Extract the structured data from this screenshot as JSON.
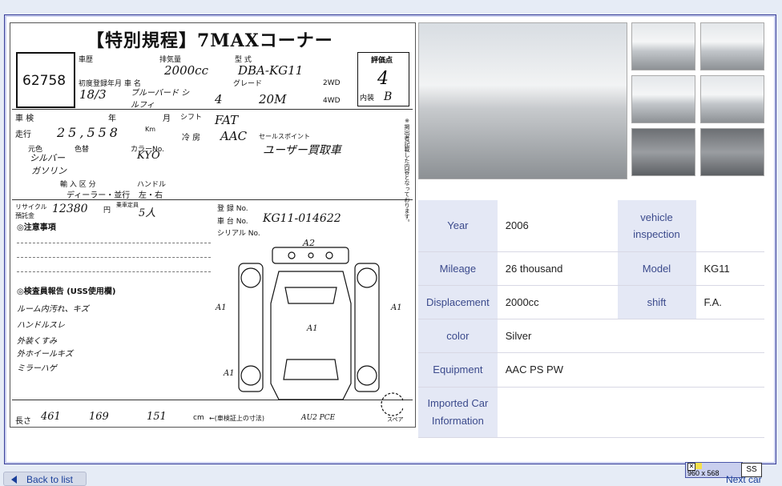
{
  "sheet": {
    "title": "【特別規程】7MAXコーナー",
    "lot_number": "62758",
    "grade_label": "評価点",
    "grade_value": "4",
    "interior_label": "内装",
    "interior_value": "B",
    "vehicle_history_label": "車歴",
    "displacement_label": "排気量",
    "displacement_value": "2000cc",
    "type_label": "型 式",
    "type_value": "DBA-KG11",
    "first_reg_label": "初度登録年月",
    "first_reg_value": "18/3",
    "name_label": "車 名",
    "name_value": "ブルーバード シルフィ",
    "doors_value": "4",
    "grade_text_label": "グレード",
    "grade_text_value": "20M",
    "drive_2wd": "2WD",
    "drive_4wd": "4WD",
    "inspection_label": "車 検",
    "inspection_year": "年",
    "inspection_month": "月",
    "shift_label": "シフト",
    "shift_value": "FAT",
    "mileage_label": "走行",
    "mileage_value": "25,558",
    "mileage_unit": "Km",
    "ac_label": "冷 房",
    "ac_value": "AAC",
    "color_label": "色替",
    "color_original_label": "元色",
    "color_original_value": "シルバー",
    "color_number_label": "カラーNo.",
    "color_number_value": "KYO",
    "fuel_value": "ガソリン",
    "sales_point_label": "セールスポイント",
    "sales_point_value": "ユーザー買取車",
    "import_label": "輸 入 区 分",
    "import_value": "ディーラー・並行",
    "handle_label": "ハンドル",
    "handle_value": "左・右",
    "recycle_label": "リサイクル預託金",
    "recycle_value": "12380",
    "recycle_unit": "円",
    "capacity_label": "乗車定員",
    "capacity_value": "5人",
    "registration_label": "登 録 No.",
    "chassis_label": "車 台 No.",
    "chassis_value": "KG11-014622",
    "serial_label": "シリアル No.",
    "notes_title": "◎注意事項",
    "inspector_title": "◎検査員報告 (USS使用欄)",
    "inspector_notes": [
      "ルーム内汚れ、キズ",
      "ハンドルスレ",
      "外装くすみ",
      "外ホイールキズ",
      "ミラーハゲ"
    ],
    "size_label": "長さ",
    "size_length": "461",
    "size_width": "169",
    "size_height": "151",
    "size_unit": "cm",
    "size_note": "←(車検証上の寸法)",
    "diagram_marks": [
      "A2",
      "A1",
      "A1",
      "A1",
      "A1"
    ],
    "diagram_note": "AU2 PCE",
    "spare_label": "スペア",
    "side_note": "※掲出者記載した内容となっております。"
  },
  "specs": [
    {
      "label1": "Year",
      "value1": "2006",
      "label2": "vehicle inspection",
      "value2": ""
    },
    {
      "label1": "Mileage",
      "value1": "26 thousand",
      "label2": "Model",
      "value2": "KG11"
    },
    {
      "label1": "Displacement",
      "value1": "2000cc",
      "label2": "shift",
      "value2": "F.A."
    },
    {
      "label1": "color",
      "value1": "Silver"
    },
    {
      "label1": "Equipment",
      "value1": "AAC PS PW"
    },
    {
      "label1": "Imported Car Information",
      "value1": ""
    }
  ],
  "footer": {
    "back_label": "Back to list",
    "size_readout": "960 x 568",
    "ss_label": "SS",
    "next_label": "Next car"
  },
  "colors": {
    "accent": "#3b4a8c",
    "header_bg": "#e4e8f5",
    "frame": "#3a3f9a"
  }
}
